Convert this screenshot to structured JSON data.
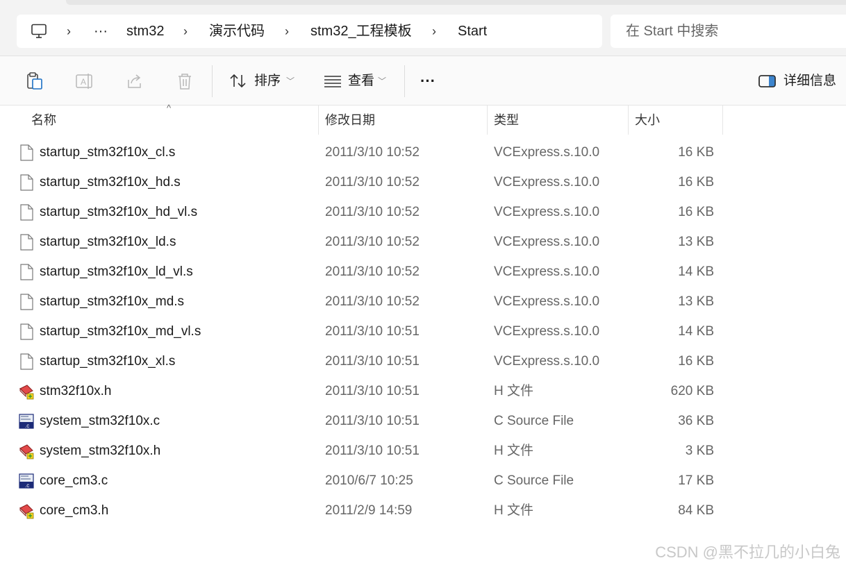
{
  "breadcrumb": {
    "overflow": "···",
    "items": [
      "stm32",
      "演示代码",
      "stm32_工程模板",
      "Start"
    ]
  },
  "search": {
    "placeholder": "在 Start 中搜索"
  },
  "toolbar": {
    "sort_label": "排序",
    "view_label": "查看",
    "more": "···",
    "details_label": "详细信息"
  },
  "columns": {
    "name": "名称",
    "date": "修改日期",
    "type": "类型",
    "size": "大小"
  },
  "files": [
    {
      "name": "startup_stm32f10x_cl.s",
      "date": "2011/3/10 10:52",
      "type": "VCExpress.s.10.0",
      "size": "16 KB",
      "icon": "blank-file-icon"
    },
    {
      "name": "startup_stm32f10x_hd.s",
      "date": "2011/3/10 10:52",
      "type": "VCExpress.s.10.0",
      "size": "16 KB",
      "icon": "blank-file-icon"
    },
    {
      "name": "startup_stm32f10x_hd_vl.s",
      "date": "2011/3/10 10:52",
      "type": "VCExpress.s.10.0",
      "size": "16 KB",
      "icon": "blank-file-icon"
    },
    {
      "name": "startup_stm32f10x_ld.s",
      "date": "2011/3/10 10:52",
      "type": "VCExpress.s.10.0",
      "size": "13 KB",
      "icon": "blank-file-icon"
    },
    {
      "name": "startup_stm32f10x_ld_vl.s",
      "date": "2011/3/10 10:52",
      "type": "VCExpress.s.10.0",
      "size": "14 KB",
      "icon": "blank-file-icon"
    },
    {
      "name": "startup_stm32f10x_md.s",
      "date": "2011/3/10 10:52",
      "type": "VCExpress.s.10.0",
      "size": "13 KB",
      "icon": "blank-file-icon"
    },
    {
      "name": "startup_stm32f10x_md_vl.s",
      "date": "2011/3/10 10:51",
      "type": "VCExpress.s.10.0",
      "size": "14 KB",
      "icon": "blank-file-icon"
    },
    {
      "name": "startup_stm32f10x_xl.s",
      "date": "2011/3/10 10:51",
      "type": "VCExpress.s.10.0",
      "size": "16 KB",
      "icon": "blank-file-icon"
    },
    {
      "name": "stm32f10x.h",
      "date": "2011/3/10 10:51",
      "type": "H 文件",
      "size": "620 KB",
      "icon": "header-file-icon"
    },
    {
      "name": "system_stm32f10x.c",
      "date": "2011/3/10 10:51",
      "type": "C Source File",
      "size": "36 KB",
      "icon": "c-source-file-icon"
    },
    {
      "name": "system_stm32f10x.h",
      "date": "2011/3/10 10:51",
      "type": "H 文件",
      "size": "3 KB",
      "icon": "header-file-icon"
    },
    {
      "name": "core_cm3.c",
      "date": "2010/6/7 10:25",
      "type": "C Source File",
      "size": "17 KB",
      "icon": "c-source-file-icon"
    },
    {
      "name": "core_cm3.h",
      "date": "2011/2/9 14:59",
      "type": "H 文件",
      "size": "84 KB",
      "icon": "header-file-icon"
    }
  ],
  "watermark": "CSDN @黑不拉几的小白兔"
}
